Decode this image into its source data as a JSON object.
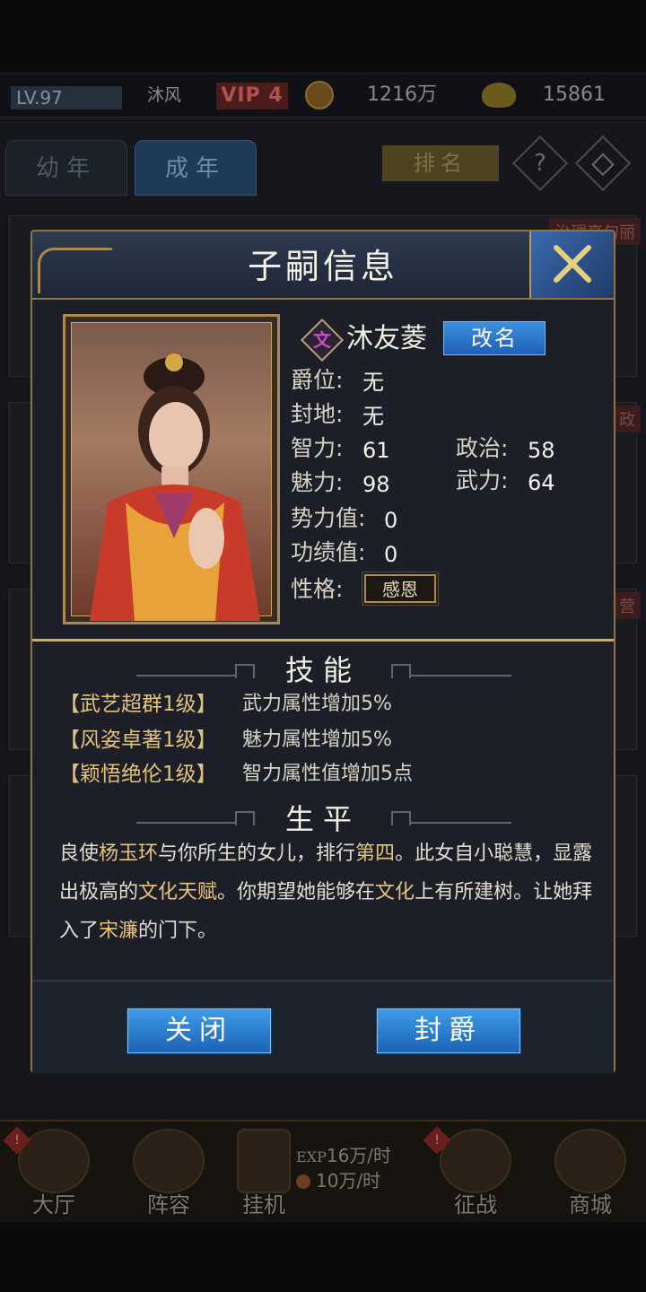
{
  "topbar": {
    "level": "LV.97",
    "player_name": "沐风",
    "vip": "VIP 4",
    "coins": "1216万",
    "ingots": "15861"
  },
  "tabs": [
    {
      "label": "幼年"
    },
    {
      "label": "成年"
    }
  ],
  "rank_label": "排名",
  "help_label": "?",
  "bg_tags": [
    "治理高句丽",
    "政",
    "营"
  ],
  "modal": {
    "title": "子嗣信息",
    "badge": "文",
    "name": "沐友菱",
    "rename_label": "改名",
    "attrs": {
      "title_label": "爵位:",
      "title_value": "无",
      "fief_label": "封地:",
      "fief_value": "无",
      "int_label": "智力:",
      "int_value": "61",
      "pol_label": "政治:",
      "pol_value": "58",
      "cha_label": "魅力:",
      "cha_value": "98",
      "str_label": "武力:",
      "str_value": "64",
      "power_label": "势力值:",
      "power_value": "0",
      "merit_label": "功绩值:",
      "merit_value": "0",
      "trait_label": "性格:",
      "trait_value": "感恩"
    },
    "skills_title": "技能",
    "skills": [
      {
        "name": "【武艺超群1级】",
        "desc": "武力属性增加5%"
      },
      {
        "name": "【风姿卓著1级】",
        "desc": "魅力属性增加5%"
      },
      {
        "name": "【颖悟绝伦1级】",
        "desc": "智力属性值增加5点"
      }
    ],
    "bio_title": "生平",
    "bio": {
      "p1": "良使",
      "h1": "杨玉环",
      "p2": "与你所生的女儿，排行",
      "h2": "第四",
      "p3": "。此女自小聪慧，显露出极高的",
      "h3": "文化天赋",
      "p4": "。你期望她能够在",
      "h4": "文化",
      "p5": "上有所建树。让她拜入了",
      "h5": "宋濂",
      "p6": "的门下。"
    },
    "close_label": "关闭",
    "ennoble_label": "封爵"
  },
  "bottom_nav": {
    "items": [
      {
        "label": "大厅",
        "icon": "hall-icon"
      },
      {
        "label": "阵容",
        "icon": "lineup-icon"
      },
      {
        "label": "挂机",
        "icon": "hourglass-icon"
      },
      {
        "label": "征战",
        "icon": "crossed-swords-icon"
      },
      {
        "label": "商城",
        "icon": "shop-chest-icon"
      }
    ],
    "exp_prefix": "EXP",
    "exp_rate": "16万/时",
    "coin_rate": "10万/时"
  },
  "colors": {
    "modal_border": "#8d7446",
    "accent_gold": "#e7c47e",
    "button_blue": "#2a7fd6",
    "badge_purple": "#c64cc6"
  }
}
